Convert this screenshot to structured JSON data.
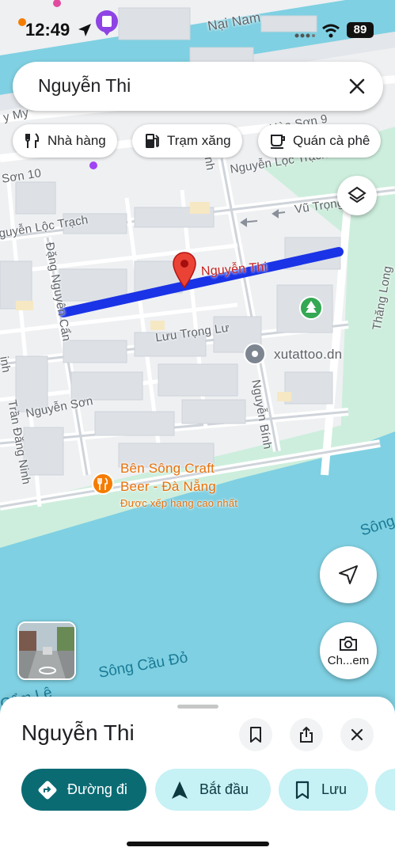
{
  "status_bar": {
    "time": "12:49",
    "battery": "89"
  },
  "search": {
    "query": "Nguyễn Thi"
  },
  "chips": [
    {
      "label": "Nhà hàng",
      "icon": "fork-knife-icon"
    },
    {
      "label": "Trạm xăng",
      "icon": "gas-station-icon"
    },
    {
      "label": "Quán cà phê",
      "icon": "coffee-cup-icon"
    }
  ],
  "map": {
    "street_labels": {
      "nai_nam": "Nại Nam",
      "hoa_son_9": "Hòa Sơn 9",
      "ay_my": "y My",
      "nguyen_loc_trach_top": "Nguyễn Lộc Trạch",
      "son_10": "Sơn 10",
      "nguyen_loc_trach_left": "guyễn Lộc Trạch",
      "vu_trong": "Vũ Trọng",
      "dang_nguyen_can": "Đặng Nguyên Cẩn",
      "luu_trong_lu": "Lưu Trọng Lư",
      "nguyen_son": "Nguyễn Sơn",
      "nguyen_binh": "Nguyễn Bính",
      "tran_dang_ninh": "Trần Đăng Ninh",
      "thang_long": "Thăng Long",
      "nh": "nh",
      "inh": "inh"
    },
    "water_labels": {
      "song_cau_do": "Sông Cầu Đỏ",
      "song_right": "Sông",
      "cam_le": "Cẩm Lệ"
    },
    "selected_street_label": "Nguyễn Thi",
    "pois": {
      "xutattoo": "xutattoo.dn",
      "ben_song_line1": "Bên Sông Craft",
      "ben_song_line2": "Beer - Đà Nẵng",
      "ben_song_sub": "Được xếp hạng cao nhất"
    },
    "colors": {
      "route": "#1a33e6",
      "pin": "#ea4335",
      "poi_food": "#f57c00",
      "park": "#34a853",
      "water": "#7fd0e2",
      "green": "#cdeedd"
    }
  },
  "controls": {
    "camera_label": "Ch...em"
  },
  "sheet": {
    "title": "Nguyễn Thi",
    "actions": [
      {
        "label": "Đường đi",
        "icon": "directions-icon"
      },
      {
        "label": "Bắt đầu",
        "icon": "navigation-arrow-icon"
      },
      {
        "label": "Lưu",
        "icon": "bookmark-icon"
      }
    ]
  }
}
